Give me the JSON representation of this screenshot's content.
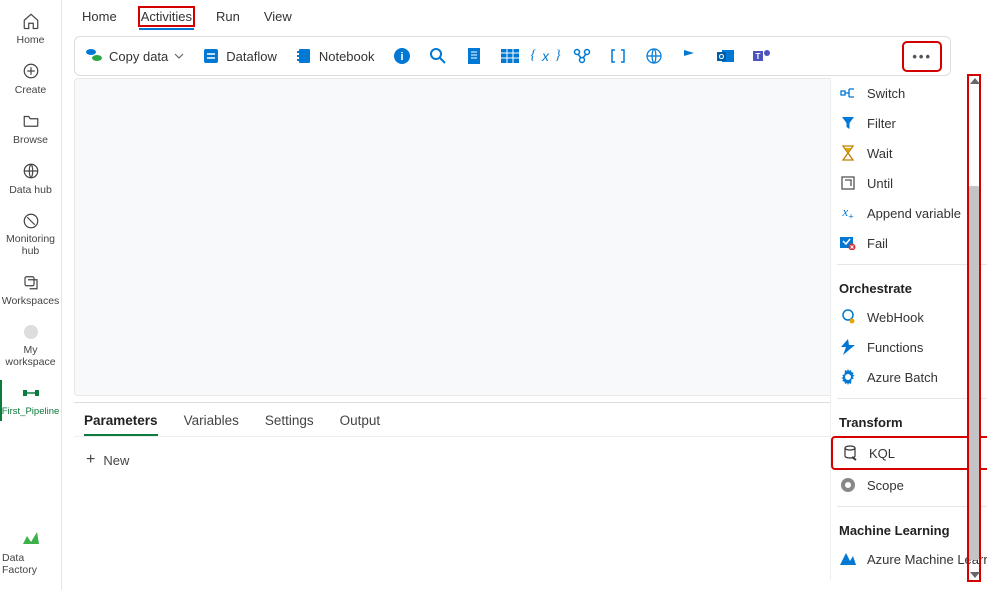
{
  "left_nav": {
    "items": [
      {
        "label": "Home",
        "icon": "home-icon"
      },
      {
        "label": "Create",
        "icon": "plus-circle-icon"
      },
      {
        "label": "Browse",
        "icon": "folder-icon"
      },
      {
        "label": "Data hub",
        "icon": "globe-data-icon"
      },
      {
        "label": "Monitoring hub",
        "icon": "monitor-icon"
      },
      {
        "label": "Workspaces",
        "icon": "stacks-icon"
      },
      {
        "label": "My workspace",
        "icon": "workspace-dot-icon"
      },
      {
        "label": "First_Pipeline",
        "icon": "pipeline-icon",
        "active": true
      }
    ],
    "footer": {
      "label": "Data Factory",
      "icon": "data-factory-icon"
    }
  },
  "tabs": {
    "items": [
      {
        "label": "Home"
      },
      {
        "label": "Activities",
        "active": true,
        "highlighted": true
      },
      {
        "label": "Run"
      },
      {
        "label": "View"
      }
    ]
  },
  "toolbar": {
    "copy_data": "Copy data",
    "dataflow": "Dataflow",
    "notebook": "Notebook",
    "more_icon": "…"
  },
  "bottom": {
    "tabs": [
      {
        "label": "Parameters",
        "active": true
      },
      {
        "label": "Variables"
      },
      {
        "label": "Settings"
      },
      {
        "label": "Output"
      }
    ],
    "new_label": "New"
  },
  "dropdown": {
    "groups": [
      {
        "title": null,
        "items": [
          {
            "label": "Switch",
            "icon": "switch-icon"
          },
          {
            "label": "Filter",
            "icon": "filter-icon"
          },
          {
            "label": "Wait",
            "icon": "hourglass-icon"
          },
          {
            "label": "Until",
            "icon": "until-icon"
          },
          {
            "label": "Append variable",
            "icon": "append-variable-icon"
          },
          {
            "label": "Fail",
            "icon": "fail-icon"
          }
        ]
      },
      {
        "title": "Orchestrate",
        "items": [
          {
            "label": "WebHook",
            "icon": "webhook-icon"
          },
          {
            "label": "Functions",
            "icon": "functions-icon"
          },
          {
            "label": "Azure Batch",
            "icon": "gear-icon"
          }
        ]
      },
      {
        "title": "Transform",
        "items": [
          {
            "label": "KQL",
            "icon": "kql-icon",
            "highlighted": true
          },
          {
            "label": "Scope",
            "icon": "scope-icon"
          }
        ]
      },
      {
        "title": "Machine Learning",
        "items": [
          {
            "label": "Azure Machine Learning",
            "icon": "ml-icon"
          }
        ]
      }
    ]
  }
}
